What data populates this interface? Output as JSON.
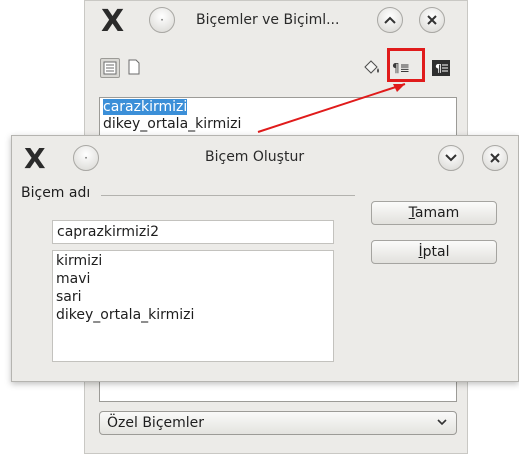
{
  "styles_window": {
    "title": "Biçemler ve Biçiml...",
    "minimize_icon": "chevron-up-icon",
    "close_icon": "close-icon",
    "toolbar": {
      "icons": [
        "paragraph-styles-icon",
        "character-styles-icon",
        "fill-format-icon",
        "new-style-from-selection-icon",
        "update-style-icon"
      ],
      "new_style_symbol": "¶≣"
    },
    "list": [
      "carazkirmizi",
      "dikey_ortala_kirmizi"
    ],
    "selected_item": "carazkirmizi",
    "category": "Özel Biçemler"
  },
  "dialog": {
    "title": "Biçem Oluştur",
    "group_label": "Biçem adı",
    "name_value": "caprazkirmizi2",
    "existing_styles": [
      "kirmizi",
      "mavi",
      "sari",
      "dikey_ortala_kirmizi"
    ],
    "ok_prefix": "",
    "ok_mnemonic": "T",
    "ok_rest": "amam",
    "cancel_mnemonic": "İ",
    "cancel_rest": "ptal"
  },
  "annotation": {
    "color": "#e01b1b"
  },
  "colors": {
    "selection": "#3b8fd8",
    "window_bg": "#ecebe8",
    "app_logo_accent": "#f1b51c"
  }
}
